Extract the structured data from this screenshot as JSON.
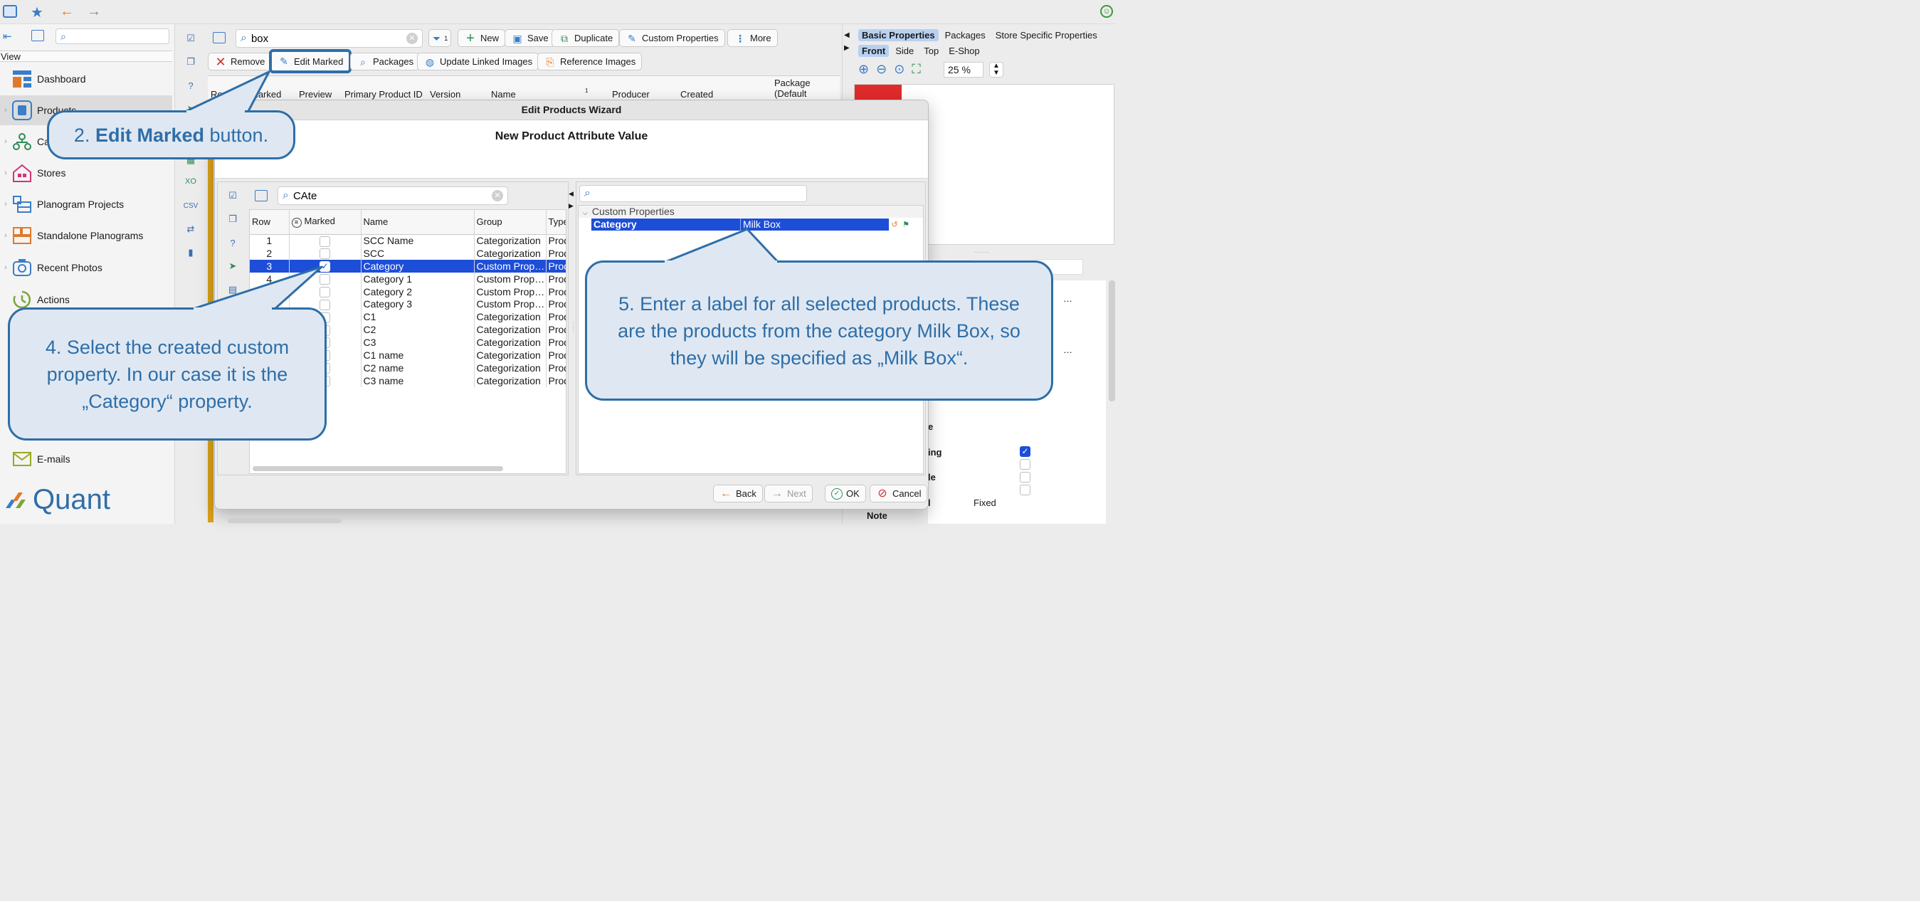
{
  "app": {
    "brand": "Quant",
    "accent": "#1d4ed8",
    "callout_border": "#2e6ea8",
    "callout_fill": "#dfe8f2"
  },
  "sidebar": {
    "view_label": "View",
    "items": [
      {
        "label": "Dashboard",
        "icon": "dashboard-icon"
      },
      {
        "label": "Products",
        "icon": "products-icon"
      },
      {
        "label": "Categories",
        "icon": "categories-icon"
      },
      {
        "label": "Stores",
        "icon": "stores-icon"
      },
      {
        "label": "Planogram Projects",
        "icon": "planogram-projects-icon"
      },
      {
        "label": "Standalone Planograms",
        "icon": "standalone-planograms-icon"
      },
      {
        "label": "Recent Photos",
        "icon": "camera-icon"
      },
      {
        "label": "Actions",
        "icon": "actions-icon"
      },
      {
        "label": "E-mails",
        "icon": "mail-icon"
      }
    ]
  },
  "toolbar": {
    "search_value": "box",
    "filter_count": "1",
    "new_label": "New",
    "save_label": "Save",
    "duplicate_label": "Duplicate",
    "custom_properties_label": "Custom Properties",
    "more_label": "More",
    "remove_label": "Remove",
    "edit_marked_label": "Edit Marked",
    "packages_label": "Packages",
    "update_linked_images_label": "Update Linked Images",
    "reference_images_label": "Reference Images"
  },
  "main_table": {
    "columns": [
      "Row",
      "Marked",
      "Preview",
      "Primary Product ID",
      "Version",
      "Name",
      "Producer",
      "Created",
      "Package (Default"
    ],
    "name_sort_index": "1"
  },
  "right_panel": {
    "tabs": [
      "Basic Properties",
      "Packages",
      "Store Specific Properties"
    ],
    "view_tabs": [
      "Front",
      "Side",
      "Top",
      "E-Shop"
    ],
    "zoom": "25 %",
    "rows": [
      "…",
      "…",
      "e",
      "ing",
      "le",
      "l",
      "Note"
    ],
    "fixed_value": "Fixed"
  },
  "dialog": {
    "title": "Edit Products Wizard",
    "subtitle": "New Product Attribute Value",
    "search_value": "CAte",
    "columns": [
      "Row",
      "Marked",
      "Name",
      "Group",
      "Type"
    ],
    "rows": [
      {
        "row": "1",
        "marked": false,
        "name": "SCC Name",
        "group": "Categorization",
        "type": "Prod"
      },
      {
        "row": "2",
        "marked": false,
        "name": "SCC",
        "group": "Categorization",
        "type": "Prod"
      },
      {
        "row": "3",
        "marked": true,
        "name": "Category",
        "group": "Custom Prop…",
        "type": "Prod"
      },
      {
        "row": "4",
        "marked": false,
        "name": "Category 1",
        "group": "Custom Prop…",
        "type": "Prod"
      },
      {
        "row": "",
        "marked": false,
        "name": "Category 2",
        "group": "Custom Prop…",
        "type": "Prod"
      },
      {
        "row": "",
        "marked": false,
        "name": "Category 3",
        "group": "Custom Prop…",
        "type": "Prod"
      },
      {
        "row": "",
        "marked": false,
        "name": "C1",
        "group": "Categorization",
        "type": "Prod"
      },
      {
        "row": "",
        "marked": false,
        "name": "C2",
        "group": "Categorization",
        "type": "Prod"
      },
      {
        "row": "",
        "marked": false,
        "name": "C3",
        "group": "Categorization",
        "type": "Prod"
      },
      {
        "row": "",
        "marked": false,
        "name": "C1 name",
        "group": "Categorization",
        "type": "Prod"
      },
      {
        "row": "",
        "marked": false,
        "name": "C2 name",
        "group": "Categorization",
        "type": "Prod"
      },
      {
        "row": "",
        "marked": false,
        "name": "C3 name",
        "group": "Categorization",
        "type": "Prod"
      }
    ],
    "props_section": "Custom Properties",
    "prop_name": "Category",
    "prop_value": "Milk Box",
    "back_label": "Back",
    "next_label": "Next",
    "ok_label": "OK",
    "cancel_label": "Cancel"
  },
  "callouts": {
    "c2_prefix": "2. ",
    "c2_bold": "Edit Marked",
    "c2_suffix": " button.",
    "c4": "4. Select the created custom property. In our case it is the „Category“ property.",
    "c5": "5. Enter a label for all selected products. These are the products from the category Milk Box, so they will be specified as „Milk Box“."
  }
}
